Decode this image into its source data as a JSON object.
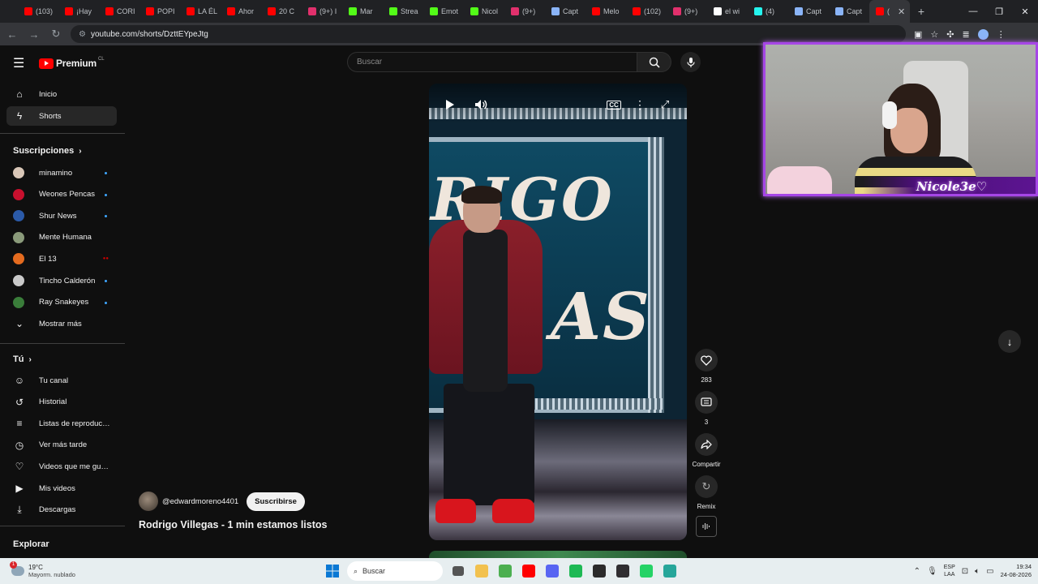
{
  "browser": {
    "tabs": [
      {
        "label": "(103)",
        "color": "#ff0000"
      },
      {
        "label": "¡Hay",
        "color": "#ff0000"
      },
      {
        "label": "CORI",
        "color": "#ff0000"
      },
      {
        "label": "POPI",
        "color": "#ff0000"
      },
      {
        "label": "LA ÉL",
        "color": "#ff0000"
      },
      {
        "label": "Ahor",
        "color": "#ff0000"
      },
      {
        "label": "20 C",
        "color": "#ff0000"
      },
      {
        "label": "(9+) I",
        "color": "#e1306c"
      },
      {
        "label": "Mar",
        "color": "#53fc18"
      },
      {
        "label": "Strea",
        "color": "#53fc18"
      },
      {
        "label": "Emot",
        "color": "#53fc18"
      },
      {
        "label": "Nicol",
        "color": "#53fc18"
      },
      {
        "label": "(9+)",
        "color": "#e1306c"
      },
      {
        "label": "Capt",
        "color": "#8ab4f8"
      },
      {
        "label": "Melo",
        "color": "#ff0000"
      },
      {
        "label": "(102)",
        "color": "#ff0000"
      },
      {
        "label": "(9+)",
        "color": "#e1306c"
      },
      {
        "label": "el wi",
        "color": "#ffffff"
      },
      {
        "label": "(4)",
        "color": "#25f4ee"
      },
      {
        "label": "Capt",
        "color": "#8ab4f8"
      },
      {
        "label": "Capt",
        "color": "#8ab4f8"
      },
      {
        "label": "(",
        "color": "#ff0000"
      }
    ],
    "new_tab": "+",
    "url": "youtube.com/shorts/DzttEYpeJtg"
  },
  "youtube": {
    "logo_word": "Premium",
    "logo_country": "CL",
    "search_placeholder": "Buscar",
    "nav": [
      {
        "label": "Inicio",
        "icon": "home-icon",
        "glyph": "⌂"
      },
      {
        "label": "Shorts",
        "icon": "shorts-icon",
        "glyph": "ϟ"
      }
    ],
    "subscriptions_title": "Suscripciones",
    "subscriptions": [
      {
        "label": "minamino",
        "color": "#d9c7b8",
        "status": "new"
      },
      {
        "label": "Weones Pencas",
        "color": "#c8102e",
        "status": "new"
      },
      {
        "label": "Shur News",
        "color": "#2b5aa8",
        "status": "new"
      },
      {
        "label": "Mente Humana",
        "color": "#8a9a7a",
        "status": "none"
      },
      {
        "label": "El 13",
        "color": "#e46b1f",
        "status": "live"
      },
      {
        "label": "Tincho Calderón",
        "color": "#c9c9c9",
        "status": "new"
      },
      {
        "label": "Ray Snakeyes",
        "color": "#3a7d3a",
        "status": "new"
      }
    ],
    "show_more": "Mostrar más",
    "you_title": "Tú",
    "you_items": [
      {
        "label": "Tu canal",
        "icon": "channel-icon",
        "glyph": "☺"
      },
      {
        "label": "Historial",
        "icon": "history-icon",
        "glyph": "↺"
      },
      {
        "label": "Listas de reproducción",
        "icon": "playlists-icon",
        "glyph": "≡"
      },
      {
        "label": "Ver más tarde",
        "icon": "watch-later-icon",
        "glyph": "◷"
      },
      {
        "label": "Videos que me gustan",
        "icon": "like-icon",
        "glyph": "♡"
      },
      {
        "label": "Mis videos",
        "icon": "my-videos-icon",
        "glyph": "▶"
      },
      {
        "label": "Descargas",
        "icon": "download-icon",
        "glyph": "⤓"
      }
    ],
    "explore_title": "Explorar"
  },
  "short": {
    "stage_text_top": "RIGO",
    "stage_text_bottom": "AS",
    "channel_handle": "@edwardmoreno4401",
    "subscribe_label": "Suscribirse",
    "title": "Rodrigo Villegas - 1 min estamos listos",
    "likes": "283",
    "comments": "3",
    "share_label": "Compartir",
    "remix_label": "Remix"
  },
  "overlay": {
    "streamer_name": "Nicole3e♡"
  },
  "taskbar": {
    "weather_badge": "1",
    "temperature": "19°C",
    "weather_desc": "Mayorm. nublado",
    "search_label": "Buscar",
    "lang_top": "ESP",
    "lang_bottom": "LAA",
    "time": "19:34",
    "date": "24-08-2026",
    "apps": [
      {
        "icon": "explorer-icon",
        "color": "#f2c14e"
      },
      {
        "icon": "chrome-icon",
        "color": "#4caf50"
      },
      {
        "icon": "youtube-icon",
        "color": "#ff0000"
      },
      {
        "icon": "discord-icon",
        "color": "#5865f2"
      },
      {
        "icon": "spotify-icon",
        "color": "#1db954"
      },
      {
        "icon": "terminal-icon",
        "color": "#2b2b2b"
      },
      {
        "icon": "obs-icon",
        "color": "#302e31"
      },
      {
        "icon": "whatsapp-icon",
        "color": "#25d366"
      },
      {
        "icon": "app-icon",
        "color": "#26a69a"
      }
    ]
  }
}
